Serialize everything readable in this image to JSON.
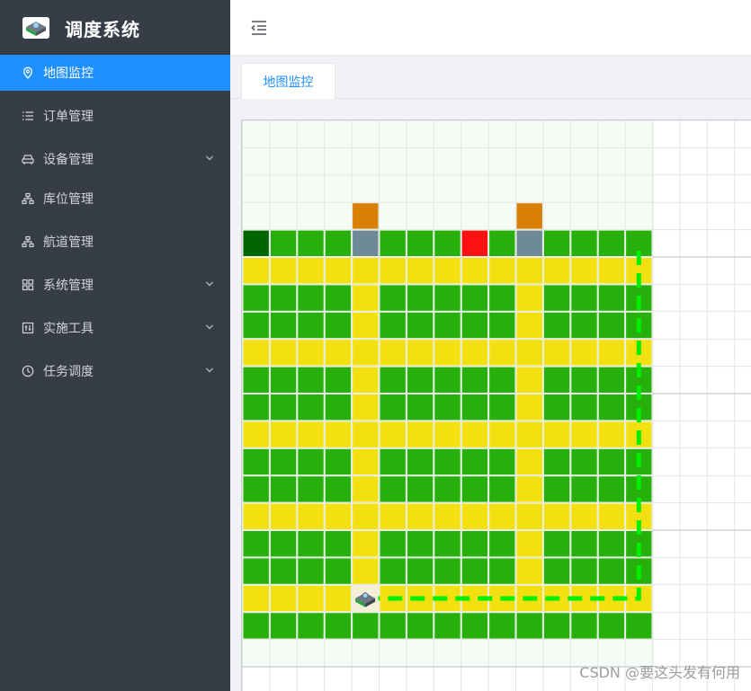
{
  "app": {
    "title": "调度系统",
    "logo_icon": "robot-logo-icon"
  },
  "sidebar": {
    "items": [
      {
        "label": "地图监控",
        "icon": "location-pin-icon",
        "active": true,
        "has_submenu": false
      },
      {
        "label": "订单管理",
        "icon": "list-icon",
        "active": false,
        "has_submenu": false
      },
      {
        "label": "设备管理",
        "icon": "car-icon",
        "active": false,
        "has_submenu": true
      },
      {
        "label": "库位管理",
        "icon": "sitemap-icon",
        "active": false,
        "has_submenu": false
      },
      {
        "label": "航道管理",
        "icon": "sitemap-icon",
        "active": false,
        "has_submenu": false
      },
      {
        "label": "系统管理",
        "icon": "grid-icon",
        "active": false,
        "has_submenu": true
      },
      {
        "label": "实施工具",
        "icon": "sliders-icon",
        "active": false,
        "has_submenu": true
      },
      {
        "label": "任务调度",
        "icon": "clock-icon",
        "active": false,
        "has_submenu": true
      }
    ]
  },
  "header": {
    "fold_icon": "menu-fold-icon"
  },
  "tabs": [
    {
      "label": "地图监控",
      "active": true
    }
  ],
  "map": {
    "colors": {
      "green": "#27b00b",
      "yellow": "#f3e010",
      "dark_green": "#006400",
      "gray": "#6f8a97",
      "red": "#ff1010",
      "orange": "#d87f06",
      "route": "#00ee00",
      "grid_line": "#e3e6e3",
      "outside": "#f7fbf6"
    },
    "legend_codes": "G=green Y=yellow D=dark_green S=gray R=red O=orange .=empty",
    "rows": [
      "...............",
      "...............",
      "...............",
      "....O.....O....",
      "DGGGSGGGRGSGGGG",
      "YYYYYYYYYYYYYYY",
      "GGGGYGGGGGYGGGG",
      "GGGGYGGGGGYGGGG",
      "YYYYYYYYYYYYYYY",
      "GGGGYGGGGGYGGGG",
      "GGGGYGGGGGYGGGG",
      "YYYYYYYYYYYYYYY",
      "GGGGYGGGGGYGGGG",
      "GGGGYGGGGGYGGGG",
      "YYYYYYYYYYYYYYY",
      "GGGGYGGGGGYGGGG",
      "GGGGYGGGGGYGGGG",
      "YYYYYYYYYYYYYYY",
      "GGGGGGGGGGGGGGG"
    ],
    "robot": {
      "row": 17,
      "col": 4,
      "icon": "agv-robot-icon"
    },
    "route": [
      [
        17,
        4
      ],
      [
        17,
        14
      ],
      [
        4,
        14
      ]
    ]
  },
  "watermark": "CSDN @要这头发有何用"
}
